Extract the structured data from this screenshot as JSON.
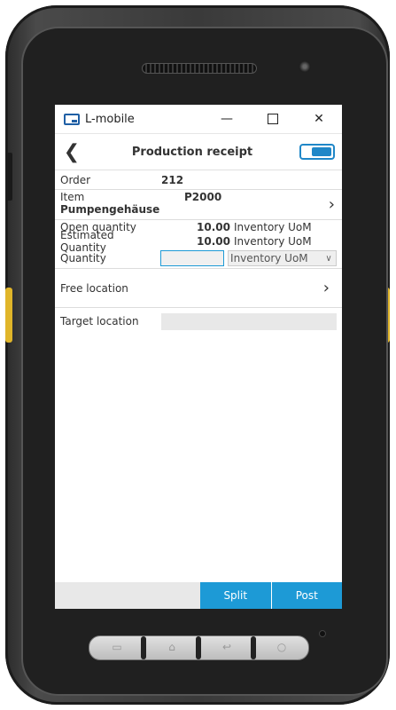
{
  "window": {
    "app_title": "L-mobile",
    "minimize_glyph": "—",
    "close_glyph": "✕"
  },
  "header": {
    "back_glyph": "❮",
    "title": "Production receipt"
  },
  "form": {
    "order": {
      "label": "Order",
      "value": "212"
    },
    "item": {
      "label": "Item",
      "value": "P2000",
      "description": "Pumpengehäuse"
    },
    "open_quantity": {
      "label": "Open quantity",
      "value": "10.00",
      "unit": "Inventory UoM"
    },
    "estimated_quantity": {
      "label": "Estimated Quantity",
      "value": "10.00",
      "unit": "Inventory UoM"
    },
    "quantity": {
      "label": "Quantity",
      "value": "",
      "unit_selected": "Inventory UoM"
    },
    "free_location": {
      "label": "Free location"
    },
    "target_location": {
      "label": "Target location",
      "value": ""
    }
  },
  "buttons": {
    "split": "Split",
    "post": "Post"
  },
  "colors": {
    "accent": "#1d9ad6",
    "logo": "#1f5fa5",
    "device_yellow": "#e0b52a"
  }
}
